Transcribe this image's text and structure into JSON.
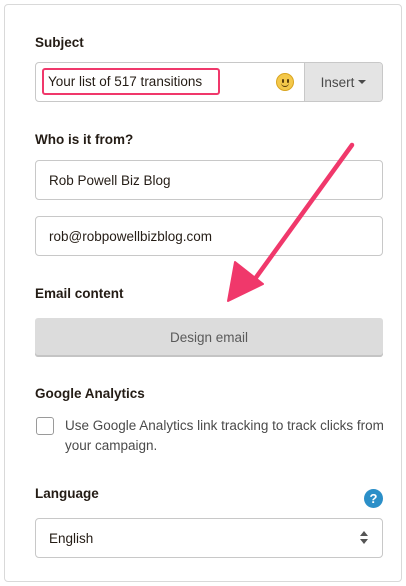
{
  "subject": {
    "label": "Subject",
    "value": "Your list of 517 transitions",
    "insert_label": "Insert"
  },
  "from": {
    "label": "Who is it from?",
    "name": "Rob Powell Biz Blog",
    "email": "rob@robpowellbizblog.com"
  },
  "content": {
    "label": "Email content",
    "button": "Design email"
  },
  "analytics": {
    "label": "Google Analytics",
    "checkbox_text": "Use Google Analytics link tracking to track clicks from your campaign."
  },
  "language": {
    "label": "Language",
    "help_glyph": "?",
    "selected": "English"
  },
  "colors": {
    "highlight": "#f0386b",
    "help": "#2b8fc8"
  }
}
